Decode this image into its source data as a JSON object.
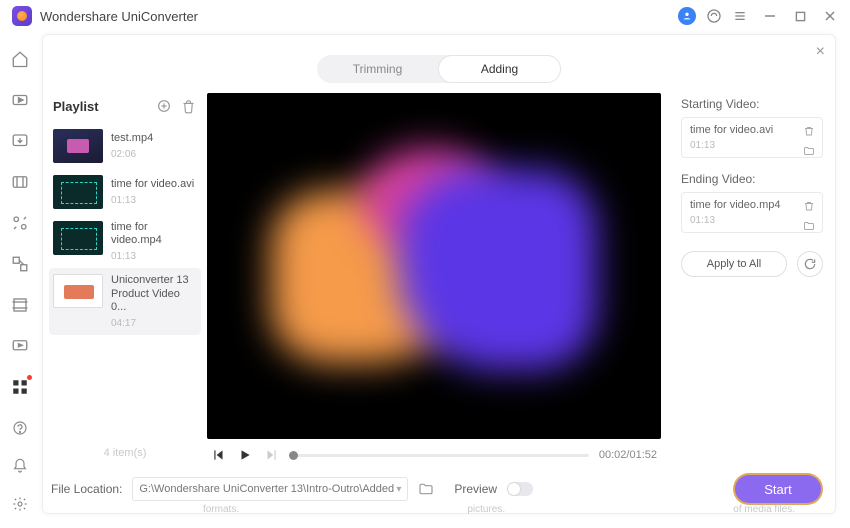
{
  "app": {
    "title": "Wondershare UniConverter"
  },
  "tabs": {
    "trimming": "Trimming",
    "adding": "Adding"
  },
  "playlist": {
    "title": "Playlist",
    "items": [
      {
        "name": "test.mp4",
        "duration": "02:06",
        "thumb": "test"
      },
      {
        "name": "time for video.avi",
        "duration": "01:13",
        "thumb": "time"
      },
      {
        "name": "time for video.mp4",
        "duration": "01:13",
        "thumb": "time"
      },
      {
        "name": "Uniconverter 13 Product Video 0...",
        "duration": "04:17",
        "thumb": "prod"
      }
    ],
    "footer": "4 item(s)"
  },
  "transport": {
    "timecode": "00:02/01:52"
  },
  "right": {
    "starting_label": "Starting Video:",
    "starting_name": "time for video.avi",
    "starting_dur": "01:13",
    "ending_label": "Ending Video:",
    "ending_name": "time for video.mp4",
    "ending_dur": "01:13",
    "apply_all": "Apply to All"
  },
  "footer": {
    "location_label": "File Location:",
    "path": "G:\\Wondershare UniConverter 13\\Intro-Outro\\Added",
    "preview_label": "Preview",
    "start": "Start"
  },
  "hints": {
    "a": "formats.",
    "b": "pictures.",
    "c": "of media files."
  }
}
